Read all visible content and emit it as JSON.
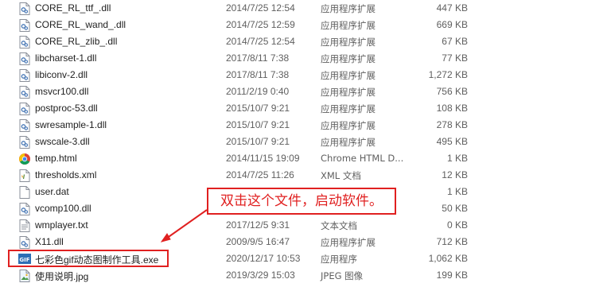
{
  "files": [
    {
      "name": "CORE_RL_ttf_.dll",
      "date": "2014/7/25 12:54",
      "type": "应用程序扩展",
      "size": "447 KB",
      "icon": "dll-icon"
    },
    {
      "name": "CORE_RL_wand_.dll",
      "date": "2014/7/25 12:59",
      "type": "应用程序扩展",
      "size": "669 KB",
      "icon": "dll-icon"
    },
    {
      "name": "CORE_RL_zlib_.dll",
      "date": "2014/7/25 12:54",
      "type": "应用程序扩展",
      "size": "67 KB",
      "icon": "dll-icon"
    },
    {
      "name": "libcharset-1.dll",
      "date": "2017/8/11 7:38",
      "type": "应用程序扩展",
      "size": "77 KB",
      "icon": "dll-icon"
    },
    {
      "name": "libiconv-2.dll",
      "date": "2017/8/11 7:38",
      "type": "应用程序扩展",
      "size": "1,272 KB",
      "icon": "dll-icon"
    },
    {
      "name": "msvcr100.dll",
      "date": "2011/2/19 0:40",
      "type": "应用程序扩展",
      "size": "756 KB",
      "icon": "dll-icon"
    },
    {
      "name": "postproc-53.dll",
      "date": "2015/10/7 9:21",
      "type": "应用程序扩展",
      "size": "108 KB",
      "icon": "dll-icon"
    },
    {
      "name": "swresample-1.dll",
      "date": "2015/10/7 9:21",
      "type": "应用程序扩展",
      "size": "278 KB",
      "icon": "dll-icon"
    },
    {
      "name": "swscale-3.dll",
      "date": "2015/10/7 9:21",
      "type": "应用程序扩展",
      "size": "495 KB",
      "icon": "dll-icon"
    },
    {
      "name": "temp.html",
      "date": "2014/11/15 19:09",
      "type": "Chrome HTML D...",
      "size": "1 KB",
      "icon": "chrome-icon"
    },
    {
      "name": "thresholds.xml",
      "date": "2014/7/25 11:26",
      "type": "XML 文档",
      "size": "12 KB",
      "icon": "xml-file-icon"
    },
    {
      "name": "user.dat",
      "date": "",
      "type": "",
      "size": "1 KB",
      "icon": "blank-file-icon"
    },
    {
      "name": "vcomp100.dll",
      "date": "",
      "type": "",
      "size": "50 KB",
      "icon": "dll-icon"
    },
    {
      "name": "wmplayer.txt",
      "date": "2017/12/5 9:31",
      "type": "文本文档",
      "size": "0 KB",
      "icon": "text-file-icon"
    },
    {
      "name": "X11.dll",
      "date": "2009/9/5 16:47",
      "type": "应用程序扩展",
      "size": "712 KB",
      "icon": "dll-icon"
    },
    {
      "name": "七彩色gif动态图制作工具.exe",
      "date": "2020/12/17 10:53",
      "type": "应用程序",
      "size": "1,062 KB",
      "icon": "gif-app-icon"
    },
    {
      "name": "使用说明.jpg",
      "date": "2019/3/29 15:03",
      "type": "JPEG 图像",
      "size": "199 KB",
      "icon": "image-file-icon"
    }
  ],
  "annotation": {
    "callout_text": "双击这个文件，启动软件。",
    "color": "#e02020"
  }
}
